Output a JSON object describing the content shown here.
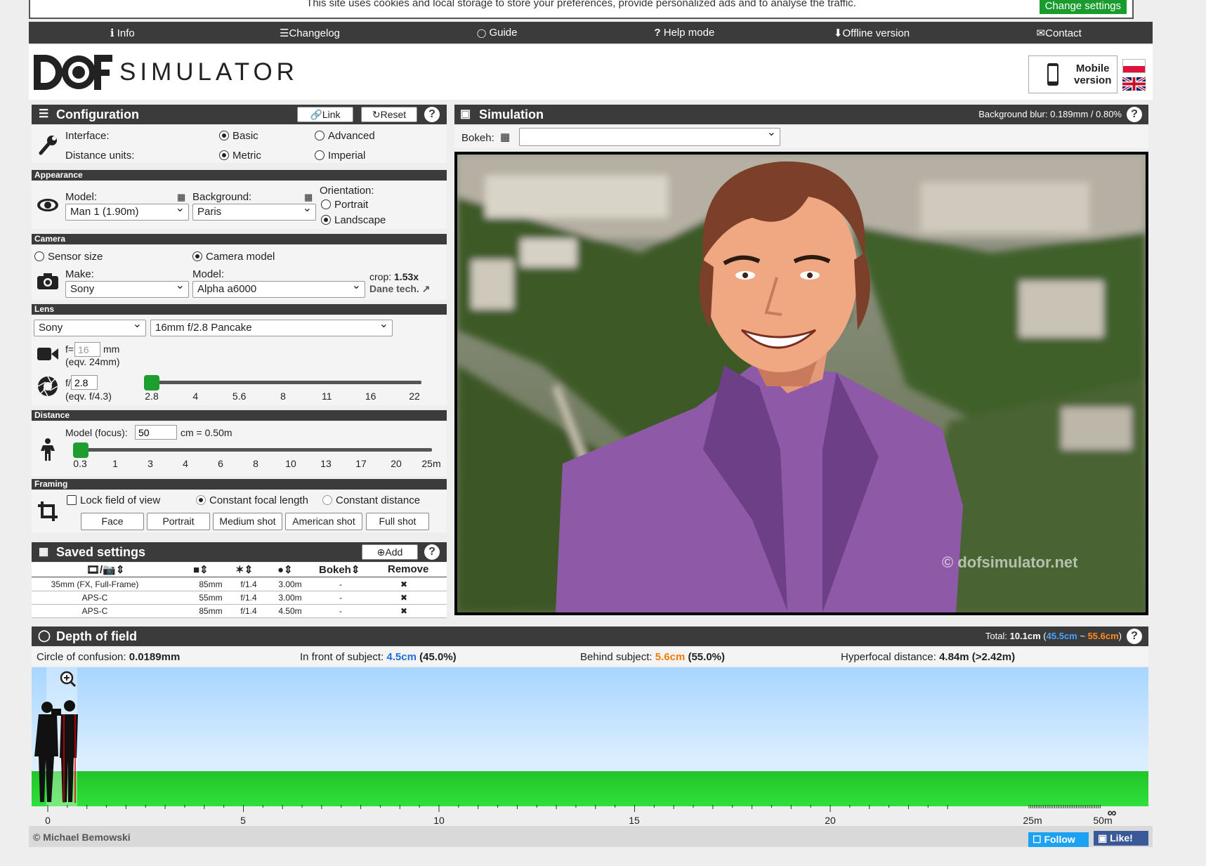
{
  "cookie": {
    "text": "This site uses cookies and local storage to store your preferences, provide personalized ads and to analyse the traffic.",
    "button": "Change settings"
  },
  "nav": [
    {
      "icon": "info-icon",
      "glyph": "ℹ",
      "label": "Info"
    },
    {
      "icon": "list-icon",
      "glyph": "☰",
      "label": "Changelog"
    },
    {
      "icon": "lightbulb-icon",
      "glyph": "💡",
      "label": "Guide"
    },
    {
      "icon": "question-icon",
      "glyph": "?",
      "label": "Help mode"
    },
    {
      "icon": "download-icon",
      "glyph": "⬇",
      "label": "Offline version"
    },
    {
      "icon": "envelope-icon",
      "glyph": "✉",
      "label": "Contact"
    }
  ],
  "logo": {
    "dof": "DOF",
    "simulator": "SIMULATOR"
  },
  "mobile": {
    "line1": "Mobile",
    "line2": "version"
  },
  "config": {
    "title": "Configuration",
    "link_btn": "Link",
    "reset_btn": "Reset",
    "interface_label": "Interface:",
    "interface_basic": "Basic",
    "interface_advanced": "Advanced",
    "units_label": "Distance units:",
    "units_metric": "Metric",
    "units_imperial": "Imperial"
  },
  "appearance": {
    "title": "Appearance",
    "model_label": "Model:",
    "model_value": "Man 1 (1.90m)",
    "background_label": "Background:",
    "background_value": "Paris",
    "orientation_label": "Orientation:",
    "portrait": "Portrait",
    "landscape": "Landscape"
  },
  "camera": {
    "title": "Camera",
    "sensor_size": "Sensor size",
    "camera_model": "Camera model",
    "make_label": "Make:",
    "make_value": "Sony",
    "model_label": "Model:",
    "model_value": "Alpha a6000",
    "crop_label": "crop:",
    "crop_value": "1.53x",
    "dane": "Dane tech."
  },
  "lens": {
    "title": "Lens",
    "make_value": "Sony",
    "lens_value": "16mm f/2.8 Pancake",
    "f_label": "f=",
    "f_value": "16",
    "f_unit": "mm",
    "eqv_focal": "(eqv. 24mm)",
    "aperture_label": "f/",
    "aperture_value": "2.8",
    "eqv_aperture": "(eqv. f/4.3)",
    "aperture_ticks": [
      "2.8",
      "4",
      "5.6",
      "8",
      "11",
      "16",
      "22"
    ],
    "aperture_position": 0
  },
  "distance": {
    "title": "Distance",
    "label": "Model (focus):",
    "value": "50",
    "unit": "cm = 0.50m",
    "ticks": [
      "0.3",
      "1",
      "3",
      "4",
      "6",
      "8",
      "10",
      "13",
      "17",
      "20",
      "25m"
    ],
    "position": 0
  },
  "framing": {
    "title": "Framing",
    "lock": "Lock field of view",
    "constant_focal": "Constant focal length",
    "constant_distance": "Constant distance",
    "buttons": [
      "Face",
      "Portrait",
      "Medium shot",
      "American shot",
      "Full shot"
    ]
  },
  "saved": {
    "title": "Saved settings",
    "add_btn": "Add",
    "col_bokeh": "Bokeh",
    "col_remove": "Remove",
    "rows": [
      {
        "sensor": "35mm (FX, Full-Frame)",
        "focal": "85mm",
        "aperture": "f/1.4",
        "distance": "3.00m",
        "bokeh": "-",
        "remove": "✖"
      },
      {
        "sensor": "APS-C",
        "focal": "55mm",
        "aperture": "f/1.4",
        "distance": "3.00m",
        "bokeh": "-",
        "remove": "✖"
      },
      {
        "sensor": "APS-C",
        "focal": "85mm",
        "aperture": "f/1.4",
        "distance": "4.50m",
        "bokeh": "-",
        "remove": "✖"
      }
    ]
  },
  "simulation": {
    "title": "Simulation",
    "blur_label": "Background blur:",
    "blur_value": "0.189mm / 0.80%",
    "bokeh_label": "Bokeh:",
    "bokeh_value": "",
    "watermark": "© dofsimulator.net"
  },
  "dof": {
    "title": "Depth of field",
    "total_label": "Total:",
    "total_value": "10.1cm",
    "near": "45.5cm",
    "far": "55.6cm",
    "coc_label": "Circle of confusion:",
    "coc_value": "0.0189mm",
    "front_label": "In front of subject:",
    "front_value": "4.5cm",
    "front_pct": "(45.0%)",
    "behind_label": "Behind subject:",
    "behind_value": "5.6cm",
    "behind_pct": "(55.0%)",
    "hyper_label": "Hyperfocal distance:",
    "hyper_value": "4.84m (>2.42m)",
    "scale_labels": [
      "0",
      "5",
      "10",
      "15",
      "20",
      "25m",
      "50m",
      "∞"
    ]
  },
  "footer": {
    "author": "© Michael Bemowski",
    "follow": "Follow",
    "like": "Like!"
  },
  "colors": {
    "dark": "#3b3b3b",
    "green": "#1d9e2e",
    "near": "#1e88e5",
    "far": "#f57c00"
  }
}
